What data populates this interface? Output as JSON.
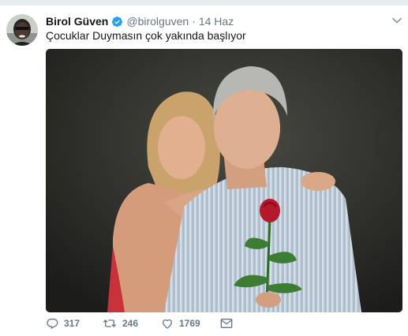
{
  "tweet": {
    "author": {
      "name": "Birol Güven",
      "handle": "@birolguven",
      "verified": true
    },
    "separator": "·",
    "date": "14 Haz",
    "text": "Çocuklar Duymasın çok yakında başlıyor",
    "photo_description_icon": "photo",
    "actions": {
      "replies": "317",
      "retweets": "246",
      "likes": "1769"
    }
  },
  "colors": {
    "text": "#14171a",
    "muted": "#657786",
    "verified_blue": "#1da1f2",
    "background": "#ffffff",
    "strip": "#e6ecf0"
  },
  "icons": [
    "avatar",
    "verified-badge-icon",
    "chevron-down-icon",
    "reply-icon",
    "retweet-icon",
    "like-icon",
    "dm-icon"
  ]
}
